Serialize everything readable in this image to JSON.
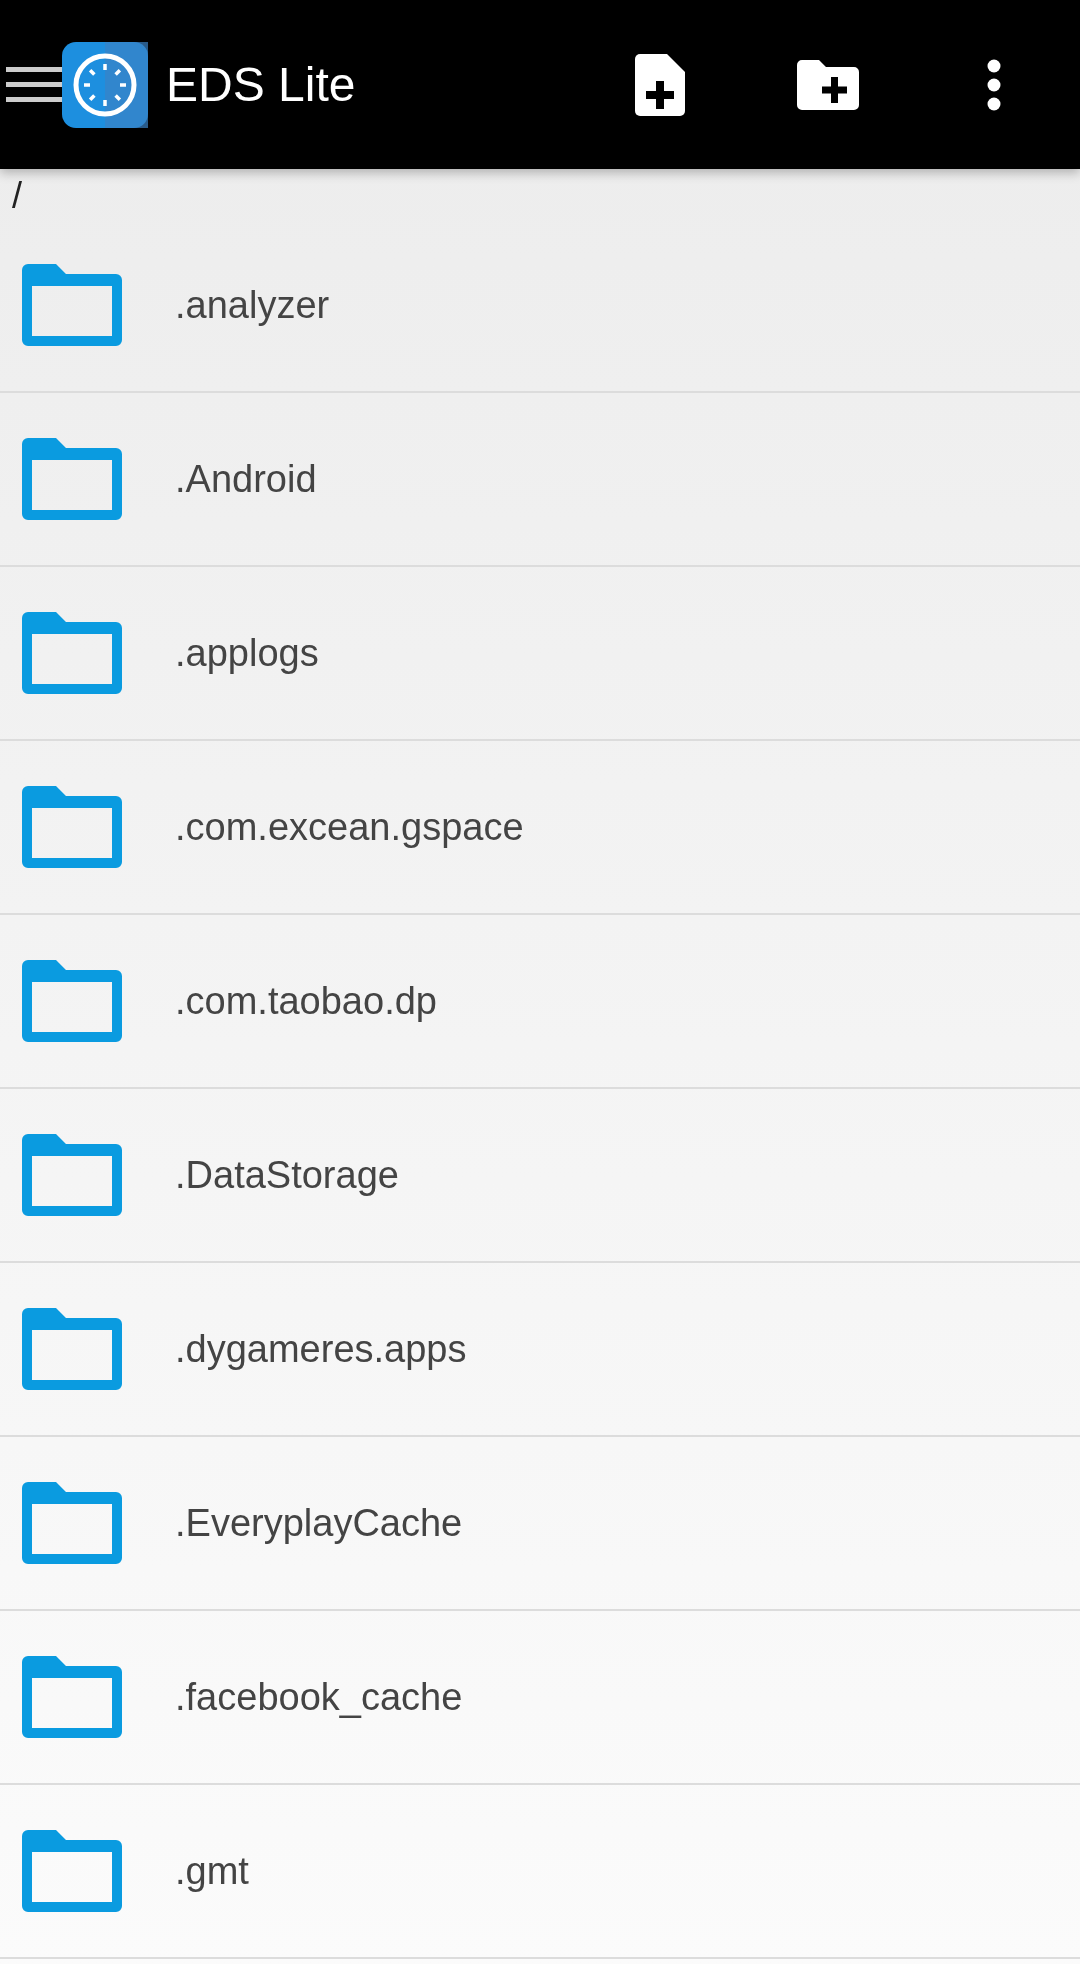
{
  "app_bar": {
    "title": "EDS Lite"
  },
  "path": "/",
  "folders": [
    {
      "name": ".analyzer"
    },
    {
      "name": ".Android"
    },
    {
      "name": ".applogs"
    },
    {
      "name": ".com.excean.gspace"
    },
    {
      "name": ".com.taobao.dp"
    },
    {
      "name": ".DataStorage"
    },
    {
      "name": ".dygameres.apps"
    },
    {
      "name": ".EveryplayCache"
    },
    {
      "name": ".facebook_cache"
    },
    {
      "name": ".gmt"
    }
  ]
}
